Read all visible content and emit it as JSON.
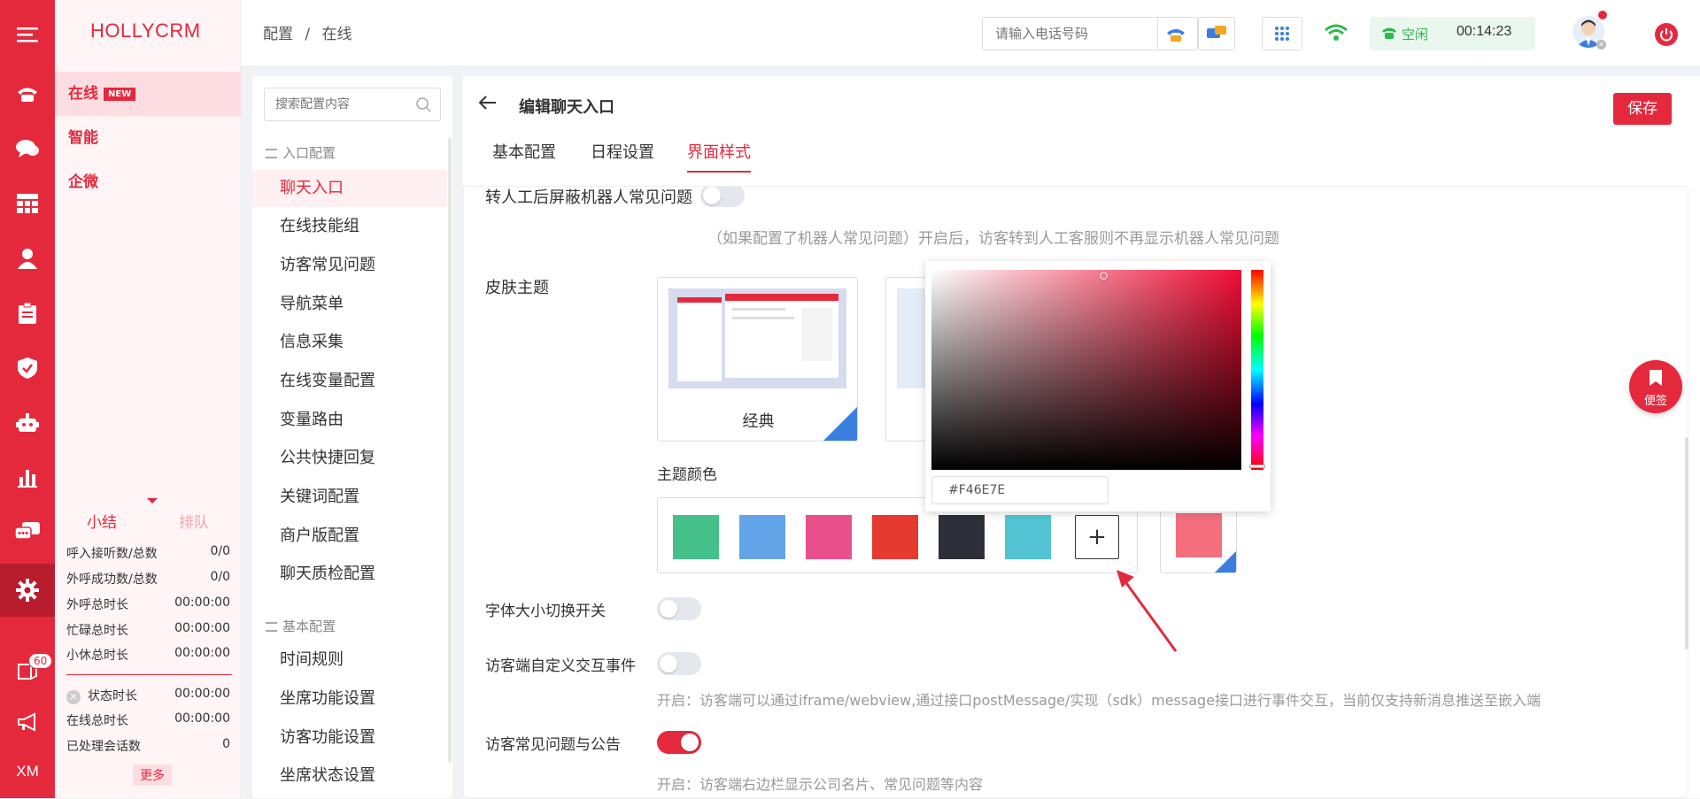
{
  "rail": {
    "items": [
      {
        "icon": "menu-icon"
      },
      {
        "icon": "phone-icon"
      },
      {
        "icon": "chat-icon"
      },
      {
        "icon": "grid-icon"
      },
      {
        "icon": "user-icon"
      },
      {
        "icon": "clipboard-icon"
      },
      {
        "icon": "shield-icon"
      },
      {
        "icon": "robot-icon"
      },
      {
        "icon": "bar-chart-icon"
      },
      {
        "icon": "message-icon"
      },
      {
        "icon": "gear-icon"
      },
      {
        "icon": "book-icon"
      },
      {
        "icon": "megaphone-icon"
      }
    ],
    "book_badge": "60",
    "bottom_label": "XM",
    "colors": {
      "rail": "#e5293d",
      "active": "#b81d2e"
    }
  },
  "left_panel": {
    "brand": "HOLLYCRM",
    "items": [
      {
        "label": "在线",
        "badge": "NEW"
      },
      {
        "label": "智能"
      },
      {
        "label": "企微"
      }
    ],
    "stat_tabs": {
      "active": "小结",
      "inactive": "排队"
    },
    "stats_a": [
      {
        "label": "呼入接听数/总数",
        "value": "0/0"
      },
      {
        "label": "外呼成功数/总数",
        "value": "0/0"
      },
      {
        "label": "外呼总时长",
        "value": "00:00:00"
      },
      {
        "label": "忙碌总时长",
        "value": "00:00:00"
      },
      {
        "label": "小休总时长",
        "value": "00:00:00"
      }
    ],
    "stats_b": [
      {
        "label": "状态时长",
        "value": "00:00:00"
      },
      {
        "label": "在线总时长",
        "value": "00:00:00"
      },
      {
        "label": "已处理会话数",
        "value": "0"
      }
    ],
    "more_label": "更多"
  },
  "header": {
    "breadcrumb": [
      "配置",
      "在线"
    ],
    "breadcrumb_sep": "/",
    "phone_placeholder": "请输入电话号码",
    "status_label": "空闲",
    "timer": "00:14:23"
  },
  "config_nav": {
    "search_placeholder": "搜索配置内容",
    "groups": [
      {
        "title": "入口配置",
        "items": [
          "聊天入口",
          "在线技能组",
          "访客常见问题",
          "导航菜单",
          "信息采集",
          "在线变量配置",
          "变量路由",
          "公共快捷回复",
          "关键词配置",
          "商户版配置",
          "聊天质检配置"
        ]
      },
      {
        "title": "基本配置",
        "items": [
          "时间规则",
          "坐席功能设置",
          "访客功能设置",
          "坐席状态设置"
        ]
      }
    ],
    "active_item": "聊天入口"
  },
  "main": {
    "title": "编辑聊天入口",
    "save_label": "保存",
    "tabs": [
      "基本配置",
      "日程设置",
      "界面样式"
    ],
    "active_tab": "界面样式",
    "robot_faq_label": "转人工后屏蔽机器人常见问题",
    "robot_faq_hint": "（如果配置了机器人常见问题）开启后，访客转到人工客服则不再显示机器人常见问题",
    "skin_label": "皮肤主题",
    "skins": [
      {
        "name": "经典",
        "selected": true
      },
      {
        "name": "",
        "selected": false
      }
    ],
    "theme_color_label": "主题颜色",
    "swatches": [
      "#46c08b",
      "#63a4e8",
      "#e94f8a",
      "#e53a30",
      "#2d3039",
      "#52c4d3"
    ],
    "selected_color": "#F46E7E",
    "font_switch_label": "字体大小切换开关",
    "font_switch_on": false,
    "custom_event_label": "访客端自定义交互事件",
    "custom_event_on": false,
    "custom_event_hint": "开启：访客端可以通过iframe/webview,通过接口postMessage/实现（sdk）message接口进行事件交互，当前仅支持新消息推送至嵌入端",
    "faq_notice_label": "访客常见问题与公告",
    "faq_notice_on": true,
    "faq_notice_hint": "开启：访客端右边栏显示公司名片、常见问题等内容"
  },
  "color_picker": {
    "hex_value": "#F46E7E"
  },
  "sticky_note": {
    "label": "便签"
  }
}
